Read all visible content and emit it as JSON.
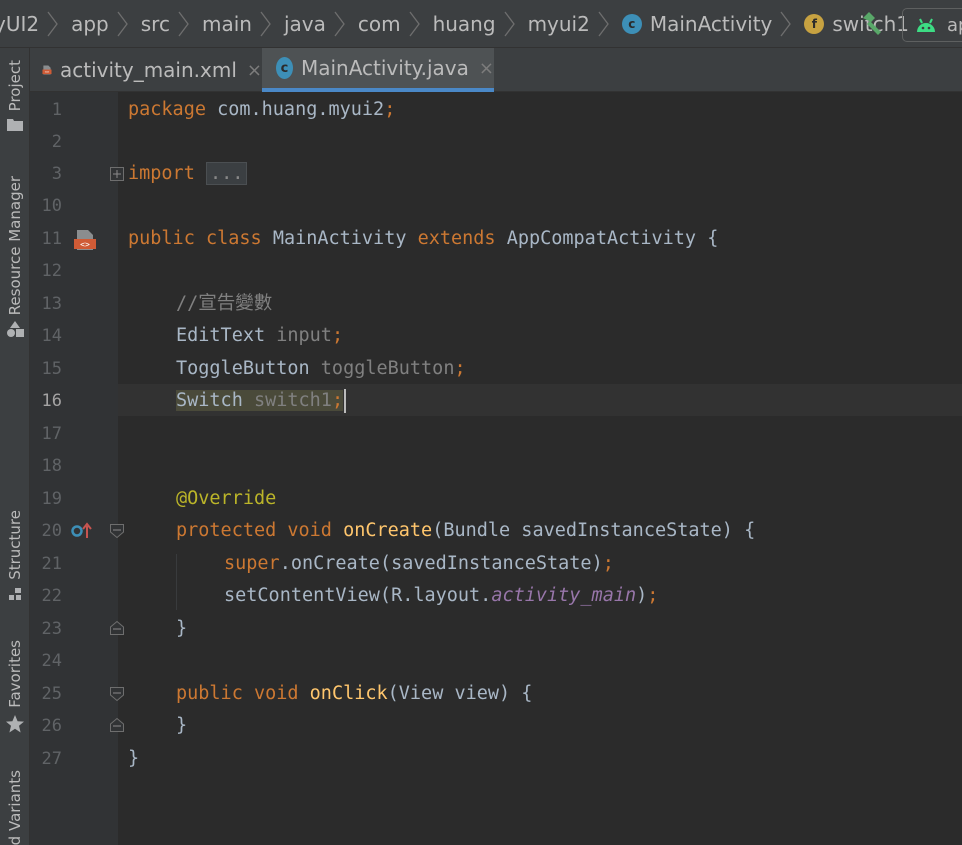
{
  "breadcrumbs": {
    "items": [
      {
        "label": "yUI2"
      },
      {
        "label": "app"
      },
      {
        "label": "src"
      },
      {
        "label": "main"
      },
      {
        "label": "java"
      },
      {
        "label": "com"
      },
      {
        "label": "huang"
      },
      {
        "label": "myui2"
      },
      {
        "label": "MainActivity",
        "icon": "class-c-icon"
      },
      {
        "label": "switch1",
        "icon": "field-f-icon"
      }
    ],
    "class_icon_letter": "c",
    "field_icon_letter": "f"
  },
  "toolbar": {
    "build_icon": "hammer-icon",
    "run_config_label": "ap",
    "run_config_icon": "android-icon"
  },
  "left_tools": {
    "project": "Project",
    "resource_manager": "Resource Manager",
    "structure": "Structure",
    "favorites": "Favorites",
    "build_variants": "d Variants"
  },
  "tabs": [
    {
      "label": "activity_main.xml",
      "icon": "xml-layout-icon",
      "active": false,
      "close": "×"
    },
    {
      "label": "MainActivity.java",
      "icon": "class-c-icon",
      "active": true,
      "close": "×"
    }
  ],
  "editor": {
    "current_line": "16",
    "line_numbers": [
      "1",
      "2",
      "3",
      "10",
      "11",
      "12",
      "13",
      "14",
      "15",
      "16",
      "17",
      "18",
      "19",
      "20",
      "21",
      "22",
      "23",
      "24",
      "25",
      "26",
      "27"
    ],
    "code": {
      "l1": {
        "kw": "package",
        "rest": " com.huang.myui2",
        "semi": ";"
      },
      "l3": {
        "kw": "import",
        "fold": "..."
      },
      "l11": {
        "kw1": "public",
        "kw2": "class",
        "name": "MainActivity",
        "kw3": "extends",
        "parent": "AppCompatActivity",
        "brace": "{"
      },
      "l13": {
        "comment": "//宣告變數"
      },
      "l14": {
        "type": "EditText",
        "var": "input",
        "semi": ";"
      },
      "l15": {
        "type": "ToggleButton",
        "var": "toggleButton",
        "semi": ";"
      },
      "l16": {
        "type": "Switch",
        "var": "switch1",
        "semi": ";"
      },
      "l19": {
        "annotation": "@Override"
      },
      "l20": {
        "kw1": "protected",
        "kw2": "void",
        "method": "onCreate",
        "params": "(Bundle savedInstanceState) {"
      },
      "l21": {
        "kw": "super",
        "rest": ".onCreate(savedInstanceState)",
        "semi": ";"
      },
      "l22": {
        "call": "setContentView(R.layout.",
        "field": "activity_main",
        "close": ")",
        "semi": ";"
      },
      "l23": {
        "brace": "}"
      },
      "l25": {
        "kw1": "public",
        "kw2": "void",
        "method": "onClick",
        "params": "(View view) {"
      },
      "l26": {
        "brace": "}"
      },
      "l27": {
        "brace": "}"
      }
    },
    "gutter_icons": {
      "l11": "xml-layout-icon",
      "l20": "override-method-icon"
    }
  }
}
